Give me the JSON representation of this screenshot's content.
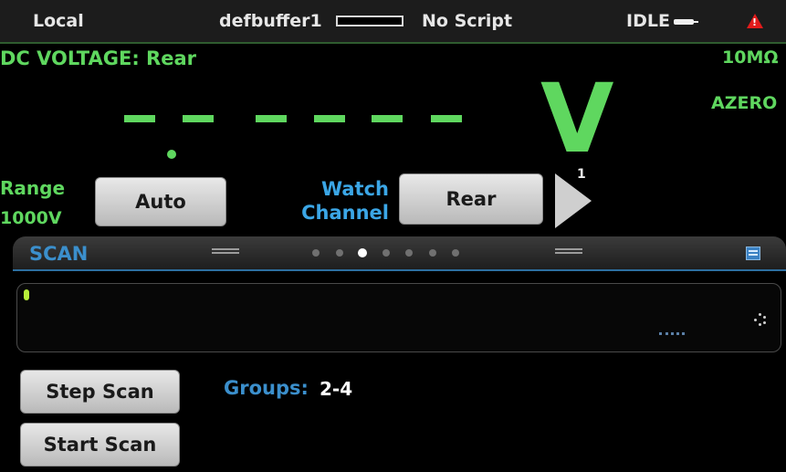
{
  "status_bar": {
    "mode": "Local",
    "buffer_name": "defbuffer1",
    "script": "No Script",
    "state": "IDLE"
  },
  "measure": {
    "function_label": "DC VOLTAGE: Rear",
    "range_setting": "10MΩ",
    "autozero": "AZERO",
    "reading_dashes": "- - - - - - -",
    "unit": "V",
    "range_label": "Range",
    "range_value": "1000V",
    "range_button_label": "Auto",
    "watch_label_line1": "Watch",
    "watch_label_line2": "Channel",
    "watch_button_label": "Rear",
    "channel_count": "1"
  },
  "swipe": {
    "title": "SCAN",
    "page_count": 7,
    "active_page": 3,
    "step_scan_label": "Step Scan",
    "start_scan_label": "Start Scan",
    "groups_label": "Groups:",
    "groups_value": "2-4"
  },
  "colors": {
    "measure_green": "#5fd75f",
    "accent_blue": "#3b8fcc",
    "alert_red": "#e21b1b"
  },
  "icons": {
    "idle": "plug-icon",
    "alert": "warning-triangle-icon",
    "next": "right-triangle-arrow-icon",
    "calculator": "calculator-icon",
    "busy": "spinner-icon"
  }
}
